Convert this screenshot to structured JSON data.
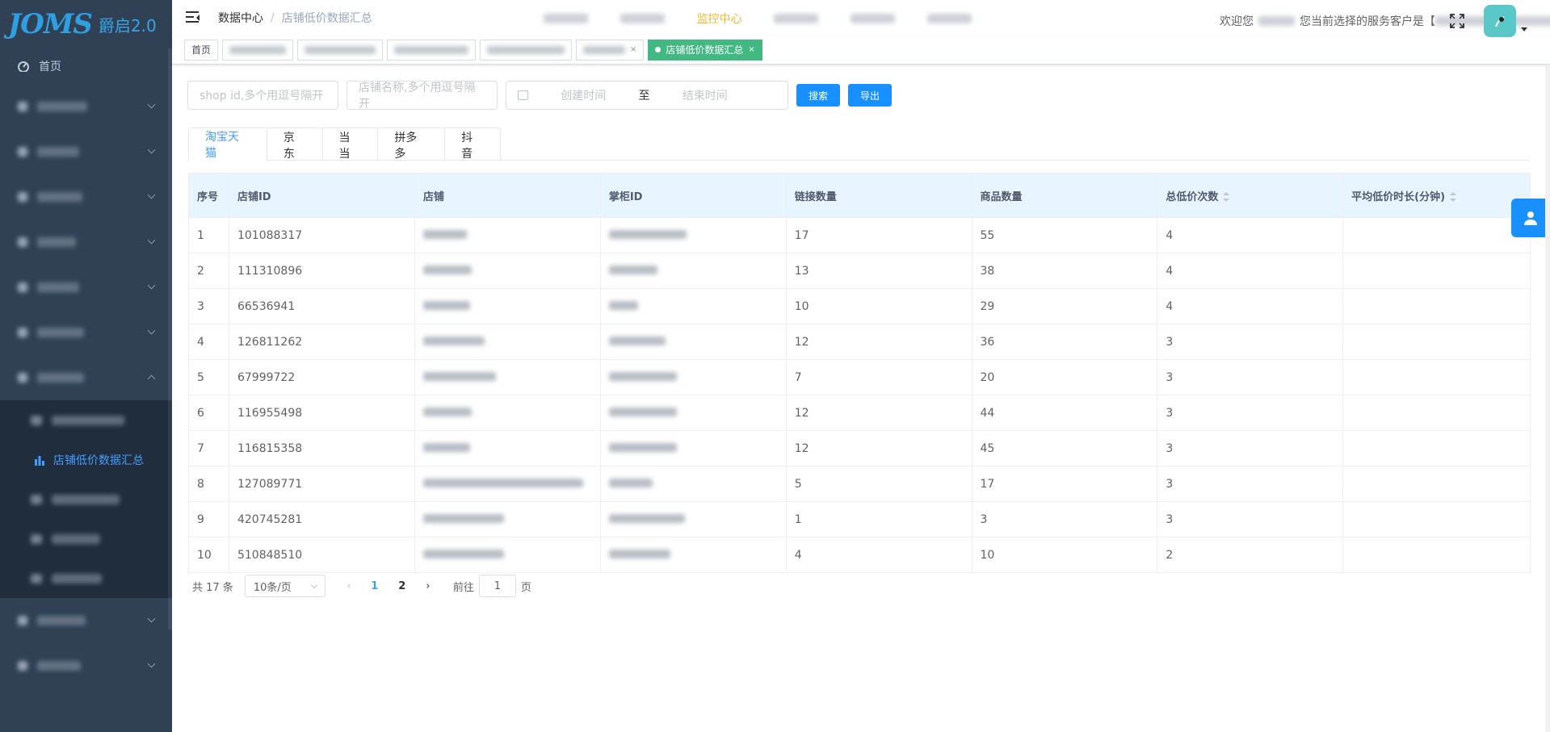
{
  "logo": {
    "mark": "JOMS",
    "title": "爵启2.0"
  },
  "sidebar": {
    "home": "首页",
    "groups": [
      {
        "label": "",
        "expanded": false
      },
      {
        "label": "",
        "expanded": false
      },
      {
        "label": "",
        "expanded": false
      },
      {
        "label": "",
        "expanded": false
      },
      {
        "label": "",
        "expanded": false
      },
      {
        "label": "",
        "expanded": false
      },
      {
        "label": "",
        "expanded": true
      }
    ],
    "sub_items": [
      {
        "label": "",
        "active": false
      },
      {
        "label": "店铺低价数据汇总",
        "active": true
      },
      {
        "label": "",
        "active": false
      },
      {
        "label": "",
        "active": false
      },
      {
        "label": "",
        "active": false
      }
    ],
    "bottom_groups": [
      {
        "label": "",
        "expanded": false
      },
      {
        "label": "",
        "expanded": false
      }
    ]
  },
  "navbar": {
    "breadcrumb": [
      "数据中心",
      "店铺低价数据汇总"
    ],
    "top_menu_highlight": "监控中心",
    "welcome_prefix": "欢迎您",
    "welcome_client": "您当前选择的服务客户是【",
    "welcome_suffix": "】!"
  },
  "tags": {
    "home": "首页",
    "active": "店铺低价数据汇总"
  },
  "filters": {
    "shop_id_placeholder": "shop id,多个用逗号隔开",
    "shop_name_placeholder": "店铺名称,多个用逗号隔开",
    "start_placeholder": "创建时间",
    "range_sep": "至",
    "end_placeholder": "结束时间",
    "search_btn": "搜索",
    "export_btn": "导出"
  },
  "tabs": [
    "淘宝天猫",
    "京东",
    "当当",
    "拼多多",
    "抖音"
  ],
  "table": {
    "columns": [
      "序号",
      "店铺ID",
      "店铺",
      "掌柜ID",
      "链接数量",
      "商品数量",
      "总低价次数",
      "平均低价时长(分钟)"
    ],
    "rows": [
      {
        "idx": "1",
        "shop_id": "101088317",
        "links": "17",
        "goods": "55",
        "times": "4"
      },
      {
        "idx": "2",
        "shop_id": "111310896",
        "links": "13",
        "goods": "38",
        "times": "4"
      },
      {
        "idx": "3",
        "shop_id": "66536941",
        "links": "10",
        "goods": "29",
        "times": "4"
      },
      {
        "idx": "4",
        "shop_id": "126811262",
        "links": "12",
        "goods": "36",
        "times": "3"
      },
      {
        "idx": "5",
        "shop_id": "67999722",
        "links": "7",
        "goods": "20",
        "times": "3"
      },
      {
        "idx": "6",
        "shop_id": "116955498",
        "links": "12",
        "goods": "44",
        "times": "3"
      },
      {
        "idx": "7",
        "shop_id": "116815358",
        "links": "12",
        "goods": "45",
        "times": "3"
      },
      {
        "idx": "8",
        "shop_id": "127089771",
        "links": "5",
        "goods": "17",
        "times": "3"
      },
      {
        "idx": "9",
        "shop_id": "420745281",
        "links": "1",
        "goods": "3",
        "times": "3"
      },
      {
        "idx": "10",
        "shop_id": "510848510",
        "links": "4",
        "goods": "10",
        "times": "2"
      }
    ]
  },
  "pager": {
    "total": "共 17 条",
    "page_size": "10条/页",
    "pages": [
      "1",
      "2"
    ],
    "goto_prefix": "前往",
    "goto_value": "1",
    "goto_suffix": "页"
  },
  "colors": {
    "sidebar_bg": "#304156",
    "primary": "#1890ff",
    "tag_active": "#42b983",
    "monitor": "#f7b731"
  }
}
